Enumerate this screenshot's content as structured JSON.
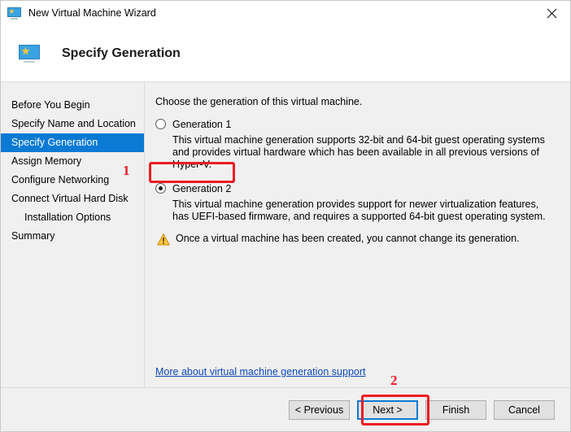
{
  "window": {
    "title": "New Virtual Machine Wizard",
    "icon": "virtual-machine-monitor-icon",
    "close_label": "✕"
  },
  "header": {
    "title": "Specify Generation",
    "icon": "virtual-machine-monitor-icon"
  },
  "sidebar": {
    "items": [
      {
        "label": "Before You Begin",
        "selected": false,
        "indent": false
      },
      {
        "label": "Specify Name and Location",
        "selected": false,
        "indent": false
      },
      {
        "label": "Specify Generation",
        "selected": true,
        "indent": false
      },
      {
        "label": "Assign Memory",
        "selected": false,
        "indent": false
      },
      {
        "label": "Configure Networking",
        "selected": false,
        "indent": false
      },
      {
        "label": "Connect Virtual Hard Disk",
        "selected": false,
        "indent": false
      },
      {
        "label": "Installation Options",
        "selected": false,
        "indent": true
      },
      {
        "label": "Summary",
        "selected": false,
        "indent": false
      }
    ],
    "selected_color": "#0a7ad4"
  },
  "main": {
    "intro": "Choose the generation of this virtual machine.",
    "options": [
      {
        "label": "Generation 1",
        "checked": false,
        "description": "This virtual machine generation supports 32-bit and 64-bit guest operating systems and provides virtual hardware which has been available in all previous versions of Hyper-V."
      },
      {
        "label": "Generation 2",
        "checked": true,
        "description": "This virtual machine generation provides support for newer virtualization features, has UEFI-based firmware, and requires a supported 64-bit guest operating system."
      }
    ],
    "warning": {
      "icon": "warning-triangle-icon",
      "text": "Once a virtual machine has been created, you cannot change its generation."
    },
    "link": {
      "text": "More about virtual machine generation support",
      "color": "#0b49b6"
    }
  },
  "footer": {
    "buttons": [
      {
        "label": "< Previous",
        "focused": false
      },
      {
        "label": "Next >",
        "focused": true
      },
      {
        "label": "Finish",
        "focused": false
      },
      {
        "label": "Cancel",
        "focused": false
      }
    ]
  },
  "annotations": {
    "marker_color": "#ec1c24",
    "markers": [
      {
        "number": "1",
        "target": "generation-2-radio-option"
      },
      {
        "number": "2",
        "target": "next-button"
      }
    ]
  }
}
